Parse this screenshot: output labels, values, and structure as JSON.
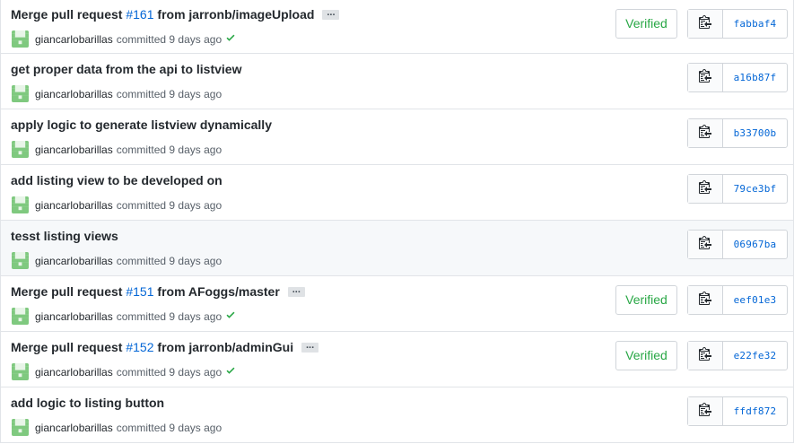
{
  "commits": [
    {
      "title_prefix": "Merge pull request ",
      "pr_number": "#161",
      "title_suffix": " from jarronb/imageUpload",
      "has_pr": true,
      "expandable": true,
      "ellipsis": "...",
      "author": "giancarlobarillas",
      "committed_text": "committed 9 days ago",
      "checked": true,
      "verified": "Verified",
      "sha": "fabbaf4"
    },
    {
      "title": "get proper data from the api to listview",
      "has_pr": false,
      "author": "giancarlobarillas",
      "committed_text": "committed 9 days ago",
      "checked": false,
      "sha": "a16b87f"
    },
    {
      "title": "apply logic to generate listview dynamically",
      "has_pr": false,
      "author": "giancarlobarillas",
      "committed_text": "committed 9 days ago",
      "checked": false,
      "sha": "b33700b"
    },
    {
      "title": "add listing view to be developed on",
      "has_pr": false,
      "author": "giancarlobarillas",
      "committed_text": "committed 9 days ago",
      "checked": false,
      "sha": "79ce3bf"
    },
    {
      "title": "tesst listing views",
      "has_pr": false,
      "highlight": true,
      "author": "giancarlobarillas",
      "committed_text": "committed 9 days ago",
      "checked": false,
      "sha": "06967ba"
    },
    {
      "title_prefix": "Merge pull request ",
      "pr_number": "#151",
      "title_suffix": " from AFoggs/master",
      "has_pr": true,
      "expandable": true,
      "ellipsis": "...",
      "author": "giancarlobarillas",
      "committed_text": "committed 9 days ago",
      "checked": true,
      "verified": "Verified",
      "sha": "eef01e3"
    },
    {
      "title_prefix": "Merge pull request ",
      "pr_number": "#152",
      "title_suffix": " from jarronb/adminGui",
      "has_pr": true,
      "expandable": true,
      "ellipsis": "...",
      "author": "giancarlobarillas",
      "committed_text": "committed 9 days ago",
      "checked": true,
      "verified": "Verified",
      "sha": "e22fe32"
    },
    {
      "title": "add logic to listing button",
      "has_pr": false,
      "author": "giancarlobarillas",
      "committed_text": "committed 9 days ago",
      "checked": false,
      "sha": "ffdf872"
    }
  ],
  "icons": {
    "avatar": "identicon-avatar",
    "check": "check-icon",
    "copy": "clippy-copy-icon"
  },
  "colors": {
    "link": "#0366d6",
    "verified": "#28a745",
    "check": "#28a745",
    "highlight_row": "#f6f8fa",
    "avatar_bg": "#b3e0b3",
    "avatar_fg": "#6cc16c"
  }
}
